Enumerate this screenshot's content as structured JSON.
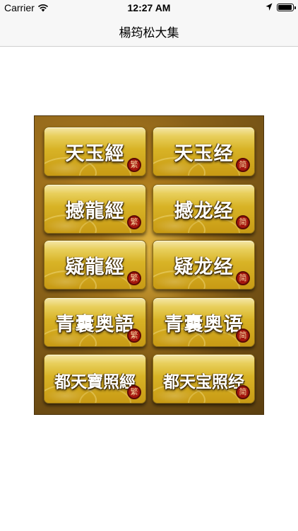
{
  "status_bar": {
    "carrier": "Carrier",
    "time": "12:27 AM",
    "wifi_icon": "wifi-icon",
    "location_icon": "location-arrow-icon",
    "battery_icon": "battery-icon",
    "battery_level": 0.95
  },
  "nav": {
    "title": "楊筠松大集"
  },
  "menu": {
    "tiles": [
      {
        "label": "天玉經",
        "seal": "繁"
      },
      {
        "label": "天玉经",
        "seal": "简"
      },
      {
        "label": "撼龍經",
        "seal": "繁"
      },
      {
        "label": "撼龙经",
        "seal": "简"
      },
      {
        "label": "疑龍經",
        "seal": "繁"
      },
      {
        "label": "疑龙经",
        "seal": "简"
      },
      {
        "label": "青囊奥語",
        "seal": "繁"
      },
      {
        "label": "青囊奥语",
        "seal": "简"
      },
      {
        "label": "都天寶照經",
        "seal": "繁"
      },
      {
        "label": "都天宝照经",
        "seal": "简"
      }
    ]
  },
  "colors": {
    "panel_brown": "#7a5616",
    "tile_gold": "#d8b326",
    "seal_red": "#a5160e"
  }
}
